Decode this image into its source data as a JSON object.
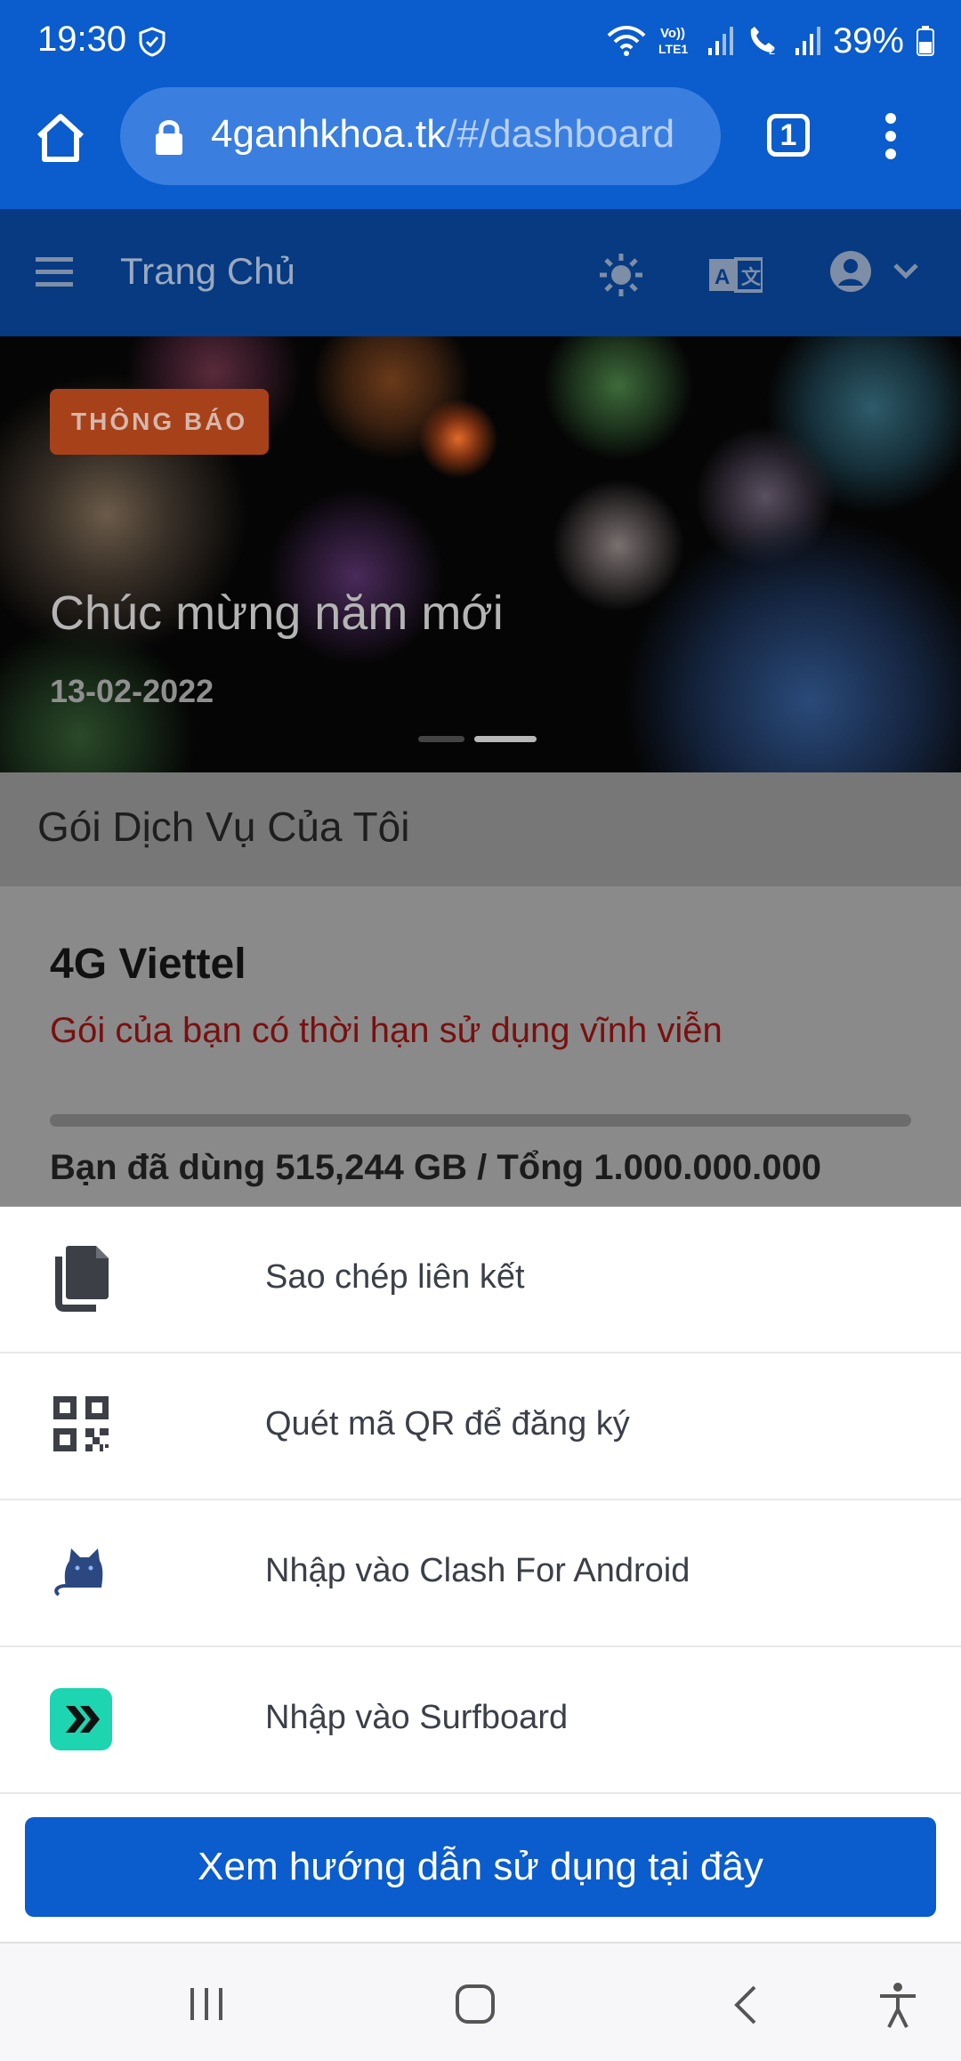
{
  "status_bar": {
    "time": "19:30",
    "battery": "39%",
    "icons": [
      "shield-icon",
      "wifi-icon",
      "volte-icon",
      "signal-icon",
      "wifi-calling-icon",
      "signal-icon",
      "battery-icon"
    ]
  },
  "browser": {
    "url_host": "4ganhkhoa.tk",
    "url_path": "/#/dashboard",
    "tab_count": "1"
  },
  "header": {
    "title": "Trang Chủ"
  },
  "banner": {
    "badge": "THÔNG BÁO",
    "title": "Chúc mừng năm mới",
    "date": "13-02-2022",
    "active_slide": 2,
    "slide_count": 2
  },
  "section": {
    "title": "Gói Dịch Vụ Của Tôi"
  },
  "plan": {
    "name": "4G Viettel",
    "validity": "Gói của bạn có thời hạn sử dụng vĩnh viễn",
    "usage": "Bạn đã dùng 515,244 GB / Tổng 1.000.000.000",
    "progress_fraction": 5e-07
  },
  "sheet": {
    "items": [
      {
        "label": "Sao chép liên kết",
        "icon": "copy-icon"
      },
      {
        "label": "Quét mã QR để đăng ký",
        "icon": "qr-code-icon"
      },
      {
        "label": "Nhập vào Clash For Android",
        "icon": "clash-cat-icon"
      },
      {
        "label": "Nhập vào Surfboard",
        "icon": "surfboard-icon"
      }
    ],
    "guide_button": "Xem hướng dẫn sử dụng tại đây"
  },
  "colors": {
    "browser_blue": "#0b5ccc",
    "header_dark": "#073a80",
    "badge": "#a6411a",
    "warning_text": "#b00000",
    "surfboard_green": "#1dd5b0"
  }
}
